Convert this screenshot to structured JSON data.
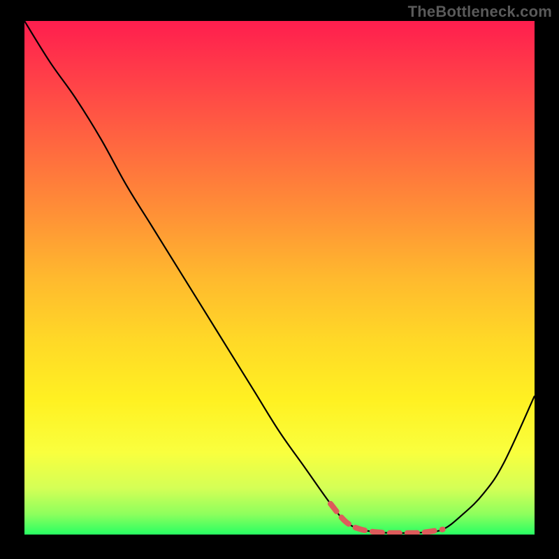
{
  "watermark": "TheBottleneck.com",
  "chart_data": {
    "type": "line",
    "title": "",
    "xlabel": "",
    "ylabel": "",
    "xlim": [
      0,
      100
    ],
    "ylim": [
      0,
      100
    ],
    "grid": false,
    "legend": false,
    "background_gradient": {
      "top_color": "#ff1e4e",
      "bottom_color": "#28ff63",
      "direction": "top-to-bottom"
    },
    "series": [
      {
        "name": "bottleneck-curve",
        "color": "#000000",
        "x": [
          0,
          5,
          10,
          15,
          20,
          25,
          30,
          35,
          40,
          45,
          50,
          55,
          60,
          63,
          66,
          70,
          74,
          78,
          82,
          86,
          90,
          94,
          100
        ],
        "values": [
          100,
          92,
          85,
          77,
          68,
          60,
          52,
          44,
          36,
          28,
          20,
          13,
          6,
          2.5,
          1,
          0.4,
          0.3,
          0.4,
          1,
          4,
          8,
          14,
          27
        ]
      }
    ],
    "markers": [
      {
        "name": "optimal-range-dash",
        "color": "#dd5b5b",
        "style": "dashed",
        "x": [
          60,
          63,
          66,
          70,
          74,
          78,
          82
        ],
        "values": [
          6,
          2.5,
          1,
          0.4,
          0.3,
          0.4,
          1
        ]
      }
    ]
  }
}
